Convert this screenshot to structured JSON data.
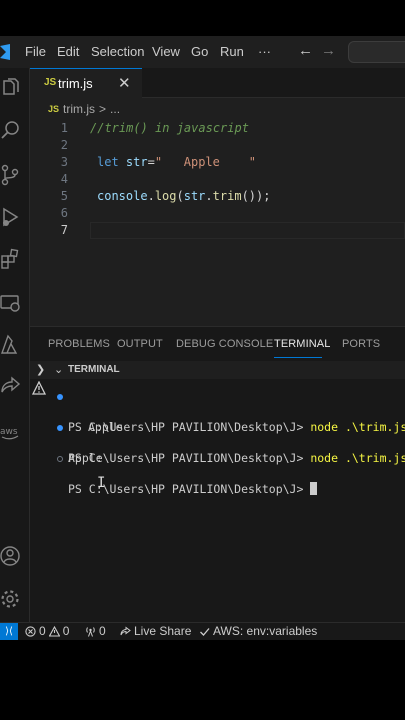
{
  "menu": {
    "items": [
      "File",
      "Edit",
      "Selection",
      "View",
      "Go",
      "Run"
    ],
    "more": "···",
    "back": "←",
    "forward": "→"
  },
  "editor": {
    "tab": {
      "icon_text": "JS",
      "label": "trim.js",
      "close": "✕"
    },
    "breadcrumb": {
      "icon_text": "JS",
      "file": "trim.js",
      "separator": ">",
      "symbol": "..."
    },
    "lines": [
      {
        "num": "1",
        "text": "//trim() in javascript"
      },
      {
        "num": "2",
        "text": ""
      },
      {
        "num": "3",
        "text": " let str=\"   Apple    \""
      },
      {
        "num": "4",
        "text": ""
      },
      {
        "num": "5",
        "text": " console.log(str.trim());"
      },
      {
        "num": "6",
        "text": ""
      },
      {
        "num": "7",
        "text": ""
      }
    ],
    "code_tokens": {
      "line1": "//trim() in javascript",
      "line3_kw": "let",
      "line3_var": "str",
      "line3_op": "=",
      "line3_str": "\"   Apple    \"",
      "line5_obj": "console",
      "line5_dot1": ".",
      "line5_fn": "log",
      "line5_open": "(",
      "line5_arg": "str",
      "line5_dot2": ".",
      "line5_fn2": "trim",
      "line5_close": "());"
    }
  },
  "panel": {
    "tabs": [
      "PROBLEMS",
      "OUTPUT",
      "DEBUG CONSOLE",
      "TERMINAL",
      "PORTS"
    ],
    "active_tab": "TERMINAL",
    "section_title": "TERMINAL",
    "terminal": {
      "prompt": "PS C:\\Users\\HP PAVILION\\Desktop\\J> ",
      "command": "node .\\trim.js",
      "output1": "Apple",
      "output2": "Apple"
    }
  },
  "statusbar": {
    "remote_icon": "remote-icon",
    "errors": "0",
    "warnings": "0",
    "ports": "0",
    "live_share": "Live Share",
    "aws": "AWS: env:variables"
  },
  "colors": {
    "accent": "#0078d4",
    "background": "#1f1f1f",
    "terminal_command": "#f5f543"
  }
}
